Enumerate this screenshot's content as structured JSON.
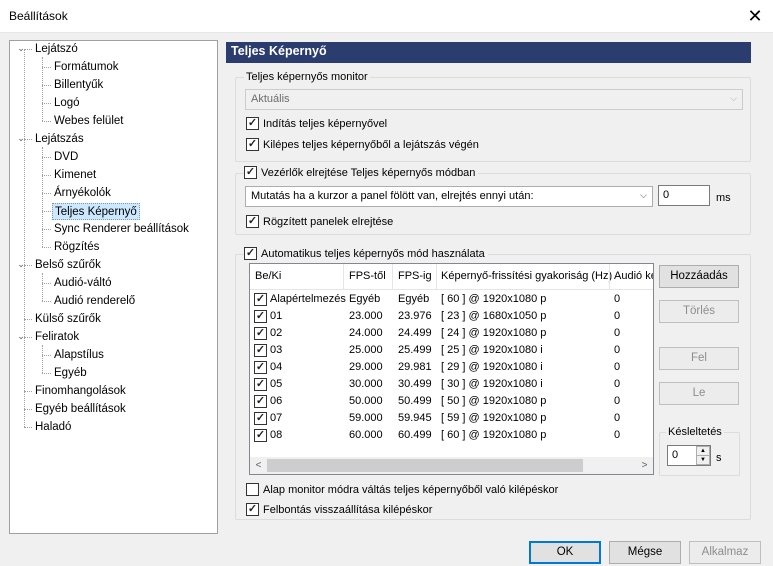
{
  "window": {
    "title": "Beállítások",
    "close_glyph": "✕"
  },
  "tree": [
    {
      "label": "Lejátszó",
      "expanded": true
    },
    {
      "label": "Formátumok"
    },
    {
      "label": "Billentyűk"
    },
    {
      "label": "Logó"
    },
    {
      "label": "Webes felület"
    },
    {
      "label": "Lejátszás",
      "expanded": true
    },
    {
      "label": "DVD"
    },
    {
      "label": "Kimenet"
    },
    {
      "label": "Árnyékolók"
    },
    {
      "label": "Teljes Képernyő",
      "selected": true
    },
    {
      "label": "Sync Renderer beállítások"
    },
    {
      "label": "Rögzítés"
    },
    {
      "label": "Belső szűrők",
      "expanded": true
    },
    {
      "label": "Audió-váltó"
    },
    {
      "label": "Audió renderelő"
    },
    {
      "label": "Külső szűrők"
    },
    {
      "label": "Feliratok",
      "expanded": true
    },
    {
      "label": "Alapstílus"
    },
    {
      "label": "Egyéb"
    },
    {
      "label": "Finomhangolások"
    },
    {
      "label": "Egyéb beállítások"
    },
    {
      "label": "Haladó"
    }
  ],
  "panel": {
    "title": "Teljes Képernyő",
    "monitor_group": "Teljes képernyős monitor",
    "monitor_value": "Aktuális",
    "launch_fullscreen": {
      "label": "Indítás teljes képernyővel",
      "checked": true
    },
    "exit_fullscreen": {
      "label": "Kilépes teljes képernyőből a lejátszás végén",
      "checked": true
    },
    "hide_controls": {
      "label": "Vezérlők elrejtése Teljes képernyős módban",
      "checked": true
    },
    "hide_mode_value": "Mutatás ha a kurzor a panel fölött van, elrejtés ennyi után:",
    "hide_delay": "0",
    "hide_delay_unit": "ms",
    "hide_docked": {
      "label": "Rögzített panelek elrejtése",
      "checked": true
    },
    "auto_mode": {
      "label": "Automatikus teljes képernyős mód használata",
      "checked": true
    },
    "columns": [
      "Be/Ki",
      "FPS-től",
      "FPS-ig",
      "Képernyő-frissítési gyakoriság (Hz)",
      "Audió ke"
    ],
    "rows": [
      {
        "label": "Alapértelmezés",
        "from": "Egyéb",
        "to": "Egyéb",
        "rate": "[ 60 ] @ 1920x1080 p",
        "audio": "0",
        "checked": true
      },
      {
        "label": "01",
        "from": "23.000",
        "to": "23.976",
        "rate": "[ 23 ] @ 1680x1050 p",
        "audio": "0",
        "checked": true
      },
      {
        "label": "02",
        "from": "24.000",
        "to": "24.499",
        "rate": "[ 24 ] @ 1920x1080 p",
        "audio": "0",
        "checked": true
      },
      {
        "label": "03",
        "from": "25.000",
        "to": "25.499",
        "rate": "[ 25 ] @ 1920x1080 i",
        "audio": "0",
        "checked": true
      },
      {
        "label": "04",
        "from": "29.000",
        "to": "29.981",
        "rate": "[ 29 ] @ 1920x1080 i",
        "audio": "0",
        "checked": true
      },
      {
        "label": "05",
        "from": "30.000",
        "to": "30.499",
        "rate": "[ 30 ] @ 1920x1080 i",
        "audio": "0",
        "checked": true
      },
      {
        "label": "06",
        "from": "50.000",
        "to": "50.499",
        "rate": "[ 50 ] @ 1920x1080 p",
        "audio": "0",
        "checked": true
      },
      {
        "label": "07",
        "from": "59.000",
        "to": "59.945",
        "rate": "[ 59 ] @ 1920x1080 p",
        "audio": "0",
        "checked": true
      },
      {
        "label": "08",
        "from": "60.000",
        "to": "60.499",
        "rate": "[ 60 ] @ 1920x1080 p",
        "audio": "0",
        "checked": true
      }
    ],
    "btn_add": "Hozzáadás",
    "btn_delete": "Törlés",
    "btn_up": "Fel",
    "btn_down": "Le",
    "delay_group": "Késleltetés",
    "delay_value": "0",
    "delay_unit": "s",
    "restore_monitor": {
      "label": "Alap monitor módra váltás teljes képernyőből való kilépéskor",
      "checked": false
    },
    "restore_resolution": {
      "label": "Felbontás visszaállítása kilépéskor",
      "checked": true
    }
  },
  "footer": {
    "ok": "OK",
    "cancel": "Mégse",
    "apply": "Alkalmaz"
  },
  "glyphs": {
    "check": "✓",
    "combo_arrow": "⌵",
    "scroll_left": "<",
    "scroll_right": ">",
    "spin_up": "▲",
    "spin_down": "▼",
    "collapse": "⌄"
  }
}
